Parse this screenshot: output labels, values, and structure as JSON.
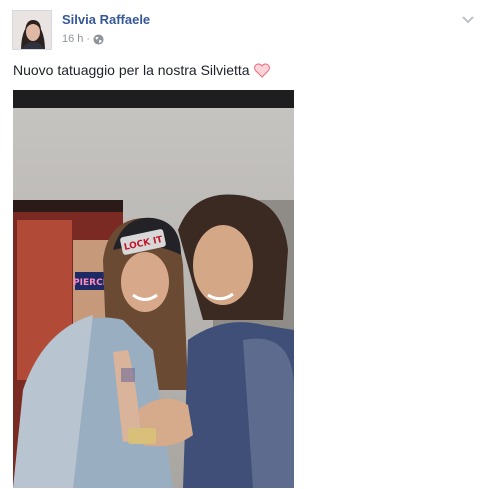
{
  "post": {
    "author_name": "Silvia Raffaele",
    "time": "16 h",
    "separator": "·",
    "privacy_icon": "globe-icon",
    "options_icon": "chevron-down-icon",
    "caption": "Nuovo tatuaggio per la nostra Silvietta",
    "caption_emoji": "heart-icon",
    "photo_text": {
      "beanie": "LOCK IT",
      "sign": "PIERCING"
    }
  },
  "colors": {
    "author_link": "#365899",
    "meta_text": "#90949c",
    "body_text": "#1d2129",
    "heart": "#f28b96"
  }
}
